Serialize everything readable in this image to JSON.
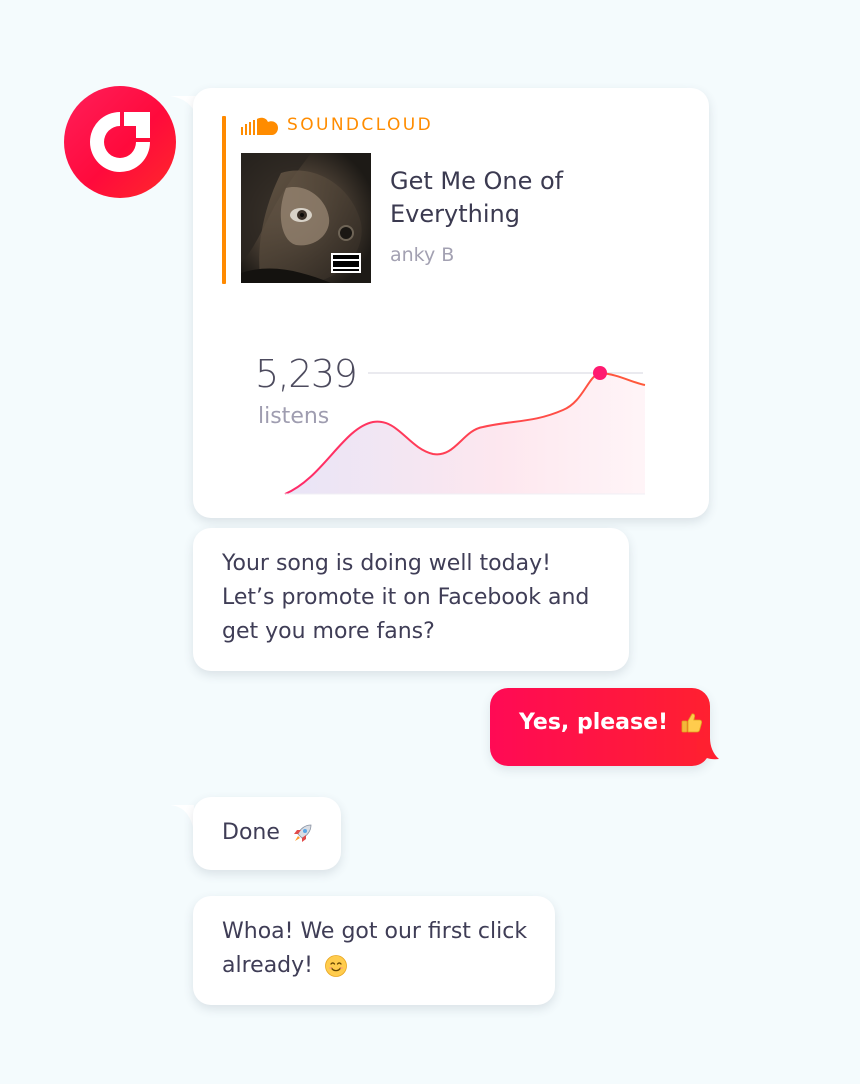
{
  "soundcloud_card": {
    "service_name": "SOUNDCLOUD",
    "track_title": "Get Me One of Everything",
    "artist": "anky B",
    "listens_count": "5,239",
    "listens_label": "listens",
    "accent_color": "#ff8c00"
  },
  "messages": [
    {
      "sender": "bot",
      "text": "Your song is doing well today! Let’s promote it on Facebook and get you more fans?"
    },
    {
      "sender": "user",
      "text": "Yes, please!",
      "emoji": "thumbs-up"
    },
    {
      "sender": "bot",
      "text": "Done",
      "emoji": "rocket"
    },
    {
      "sender": "bot",
      "text": "Whoa! We got our first click already!",
      "emoji": "smiling-face"
    }
  ],
  "colors": {
    "brand_gradient_start": "#ff0a55",
    "brand_gradient_end": "#ff2030",
    "background": "#f4fbfd",
    "chart_line": "#ff3a5c"
  },
  "icons": {
    "avatar": "brand-logo-icon",
    "service": "soundcloud-cloud-icon"
  }
}
